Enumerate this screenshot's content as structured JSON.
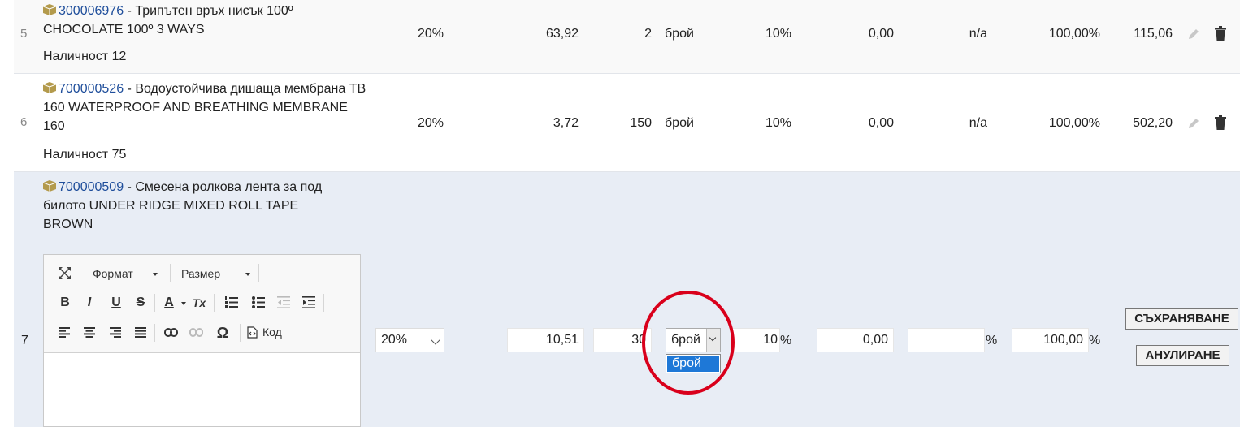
{
  "rows": [
    {
      "num": "5",
      "code": "300006976",
      "name": " - Трипътен връх нисък 100º CHOCOLATE 100º 3 WAYS",
      "stock": "Наличност 12",
      "vat": "20%",
      "price": "63,92",
      "qty": "2",
      "unit": "брой",
      "discount": "10%",
      "extra": "0,00",
      "na": "n/a",
      "percent": "100,00%",
      "total": "115,06"
    },
    {
      "num": "6",
      "code": "700000526",
      "name": " - Водоустойчива дишаща мембрана TB 160 WATERPROOF AND BREATHING MEMBRANE 160",
      "stock": "Наличност 75",
      "vat": "20%",
      "price": "3,72",
      "qty": "150",
      "unit": "брой",
      "discount": "10%",
      "extra": "0,00",
      "na": "n/a",
      "percent": "100,00%",
      "total": "502,20"
    }
  ],
  "edit_row": {
    "num": "7",
    "code": "700000509",
    "name": " - Смесена ролкова лента за под билото UNDER RIDGE MIXED ROLL TAPE BROWN",
    "vat_select": "20%",
    "price": "10,51",
    "qty": "30",
    "unit_select": "брой",
    "unit_option": "брой",
    "discount": "10",
    "discount_suffix": "%",
    "extra": "0,00",
    "blank": "",
    "blank_suffix": "%",
    "percent": "100,00",
    "percent_suffix": "%",
    "save_label": "СЪХРАНЯВАНЕ",
    "cancel_label": "АНУЛИРАНЕ"
  },
  "editor": {
    "format_label": "Формат",
    "size_label": "Размер",
    "source_label": "Код",
    "bold": "B",
    "italic": "I",
    "underline": "U",
    "strike": "S",
    "font_color": "A",
    "remove_format": "Tx",
    "special_char": "Ω"
  },
  "colors": {
    "code_link": "#1f4e9b",
    "highlight_circle": "#d9001b",
    "selected_option": "#1e78d7"
  }
}
